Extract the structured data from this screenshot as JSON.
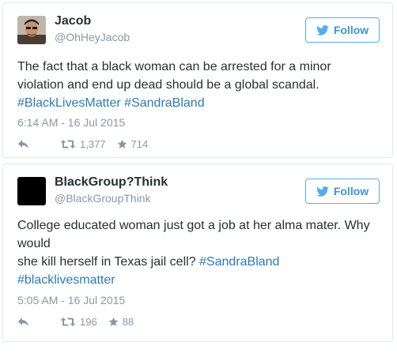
{
  "colors": {
    "link": "#2b7bb9",
    "follow_accent": "#55acee",
    "muted": "#8899a6",
    "text": "#292f33",
    "border": "#e1e8ed"
  },
  "tweets": [
    {
      "name": "Jacob",
      "handle": "@OhHeyJacob",
      "avatar_icon": "user-photo",
      "follow_label": "Follow",
      "text_lines": [
        "The fact that a black woman can be arrested for a minor",
        "violation and end up dead should be a global scandal."
      ],
      "hashtags": [
        "#BlackLivesMatter",
        "#SandraBland"
      ],
      "timestamp": "6:14 AM - 16 Jul 2015",
      "retweets": "1,377",
      "favorites": "714"
    },
    {
      "name": "BlackGroup?Think",
      "handle": "@BlackGroupThink",
      "avatar_icon": "black-square",
      "follow_label": "Follow",
      "text_lines": [
        "College educated woman just got a job at her alma mater. Why",
        "would",
        "she kill herself in Texas jail cell? "
      ],
      "hashtags": [
        "#SandraBland",
        "#blacklivesmatter"
      ],
      "timestamp": "5:05 AM - 16 Jul 2015",
      "retweets": "196",
      "favorites": "88"
    }
  ]
}
